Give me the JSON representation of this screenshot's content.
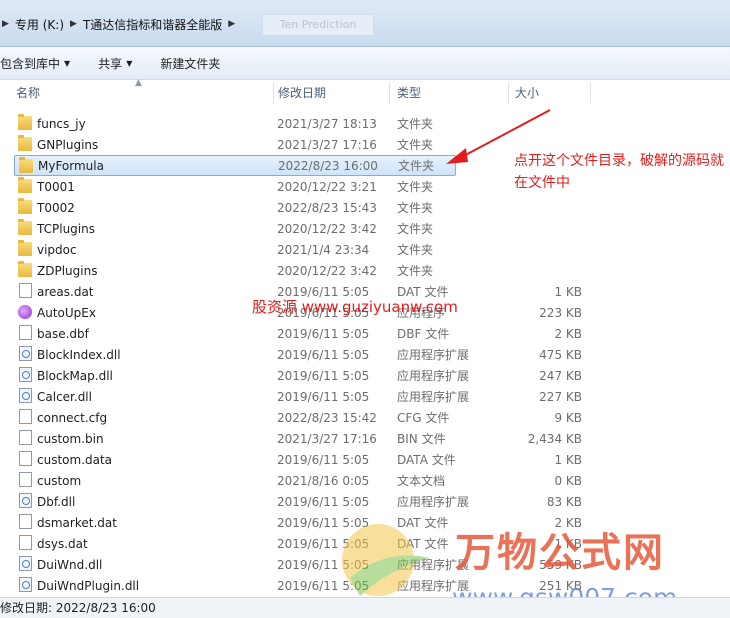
{
  "address": {
    "crumbs": [
      "专用 (K:)",
      "T通达信指标和谐器全能版"
    ],
    "ghost": "Ten Prediction"
  },
  "toolbar": {
    "include_library": "包含到库中",
    "share": "共享",
    "new_folder": "新建文件夹"
  },
  "columns": {
    "name": "名称",
    "date": "修改日期",
    "type": "类型",
    "size": "大小"
  },
  "files": [
    {
      "name": "funcs_jy",
      "date": "2021/3/27 18:13",
      "type": "文件夹",
      "size": "",
      "icon": "folder-icon"
    },
    {
      "name": "GNPlugins",
      "date": "2021/3/27 17:16",
      "type": "文件夹",
      "size": "",
      "icon": "folder-icon"
    },
    {
      "name": "MyFormula",
      "date": "2022/8/23 16:00",
      "type": "文件夹",
      "size": "",
      "icon": "folder-icon",
      "selected": true
    },
    {
      "name": "T0001",
      "date": "2020/12/22 3:21",
      "type": "文件夹",
      "size": "",
      "icon": "folder-icon"
    },
    {
      "name": "T0002",
      "date": "2022/8/23 15:43",
      "type": "文件夹",
      "size": "",
      "icon": "folder-icon"
    },
    {
      "name": "TCPlugins",
      "date": "2020/12/22 3:42",
      "type": "文件夹",
      "size": "",
      "icon": "folder-icon"
    },
    {
      "name": "vipdoc",
      "date": "2021/1/4 23:34",
      "type": "文件夹",
      "size": "",
      "icon": "folder-icon"
    },
    {
      "name": "ZDPlugins",
      "date": "2020/12/22 3:42",
      "type": "文件夹",
      "size": "",
      "icon": "folder-icon"
    },
    {
      "name": "areas.dat",
      "date": "2019/6/11 5:05",
      "type": "DAT 文件",
      "size": "1 KB",
      "icon": "file-icon"
    },
    {
      "name": "AutoUpEx",
      "date": "2019/6/11 5:05",
      "type": "应用程序",
      "size": "223 KB",
      "icon": "exe-icon"
    },
    {
      "name": "base.dbf",
      "date": "2019/6/11 5:05",
      "type": "DBF 文件",
      "size": "2 KB",
      "icon": "file-icon"
    },
    {
      "name": "BlockIndex.dll",
      "date": "2019/6/11 5:05",
      "type": "应用程序扩展",
      "size": "475 KB",
      "icon": "dll-icon"
    },
    {
      "name": "BlockMap.dll",
      "date": "2019/6/11 5:05",
      "type": "应用程序扩展",
      "size": "247 KB",
      "icon": "dll-icon"
    },
    {
      "name": "Calcer.dll",
      "date": "2019/6/11 5:05",
      "type": "应用程序扩展",
      "size": "227 KB",
      "icon": "dll-icon"
    },
    {
      "name": "connect.cfg",
      "date": "2022/8/23 15:42",
      "type": "CFG 文件",
      "size": "9 KB",
      "icon": "file-icon"
    },
    {
      "name": "custom.bin",
      "date": "2021/3/27 17:16",
      "type": "BIN 文件",
      "size": "2,434 KB",
      "icon": "file-icon"
    },
    {
      "name": "custom.data",
      "date": "2019/6/11 5:05",
      "type": "DATA 文件",
      "size": "1 KB",
      "icon": "file-icon"
    },
    {
      "name": "custom",
      "date": "2021/8/16 0:05",
      "type": "文本文档",
      "size": "0 KB",
      "icon": "file-icon"
    },
    {
      "name": "Dbf.dll",
      "date": "2019/6/11 5:05",
      "type": "应用程序扩展",
      "size": "83 KB",
      "icon": "dll-icon"
    },
    {
      "name": "dsmarket.dat",
      "date": "2019/6/11 5:05",
      "type": "DAT 文件",
      "size": "2 KB",
      "icon": "file-icon"
    },
    {
      "name": "dsys.dat",
      "date": "2019/6/11 5:05",
      "type": "DAT 文件",
      "size": "1 KB",
      "icon": "file-icon"
    },
    {
      "name": "DuiWnd.dll",
      "date": "2019/6/11 5:05",
      "type": "应用程序扩展",
      "size": "559 KB",
      "icon": "dll-icon"
    },
    {
      "name": "DuiWndPlugin.dll",
      "date": "2019/6/11 5:05",
      "type": "应用程序扩展",
      "size": "251 KB",
      "icon": "dll-icon"
    }
  ],
  "annotation": "点开这个文件目录，破解的源码就在文件中",
  "watermarks": {
    "site1": "股资源 www.guziyuanw.com",
    "brand": "万物公式网",
    "site2": "www.gsw007.com"
  },
  "status": "修改日期: 2022/8/23 16:00",
  "colors": {
    "annotation": "#e11d1d",
    "selection": "#cfe4fa"
  }
}
